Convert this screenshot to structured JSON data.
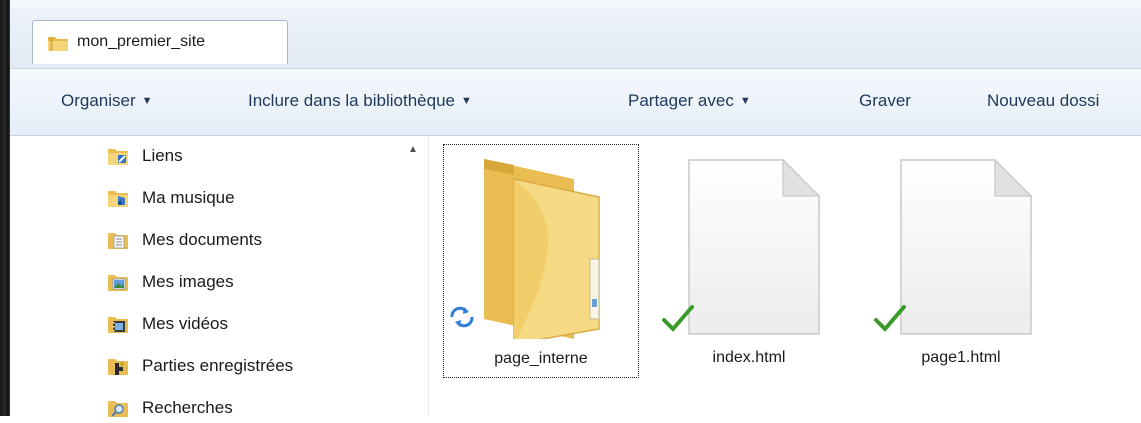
{
  "window": {
    "tab_title": "mon_premier_site"
  },
  "toolbar": {
    "organize": "Organiser",
    "include_library": "Inclure dans la bibliothèque",
    "share_with": "Partager avec",
    "burn": "Graver",
    "new_folder": "Nouveau dossi"
  },
  "sidebar": {
    "items": [
      {
        "label": "Liens",
        "icon": "links-icon"
      },
      {
        "label": "Ma musique",
        "icon": "music-folder-icon"
      },
      {
        "label": "Mes documents",
        "icon": "documents-folder-icon"
      },
      {
        "label": "Mes images",
        "icon": "pictures-folder-icon"
      },
      {
        "label": "Mes vidéos",
        "icon": "videos-folder-icon"
      },
      {
        "label": "Parties enregistrées",
        "icon": "saved-games-icon"
      },
      {
        "label": "Recherches",
        "icon": "searches-icon"
      }
    ]
  },
  "files": [
    {
      "name": "page_interne",
      "type": "folder",
      "status": "syncing",
      "selected": true
    },
    {
      "name": "index.html",
      "type": "file",
      "status": "synced"
    },
    {
      "name": "page1.html",
      "type": "file",
      "status": "synced"
    }
  ],
  "colors": {
    "toolbar_text": "#1e395b",
    "folder_yellow": "#f2cf6b",
    "sync_blue": "#2f7fd8",
    "check_green": "#3a9a2a"
  }
}
